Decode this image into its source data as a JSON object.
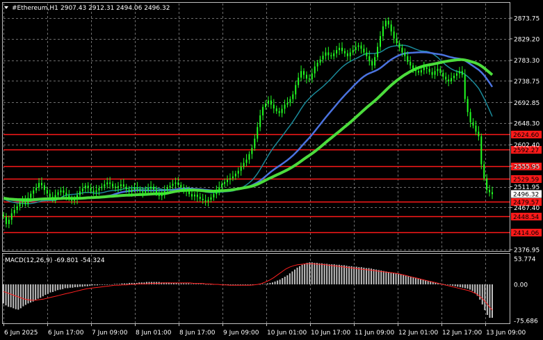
{
  "header": {
    "symbol": "#Ethereum,H1",
    "ohlc": "2907.43 2912.31 2494.06 2496.32"
  },
  "macd": {
    "label": "MACD(12,26,9) -69.801 -54.324",
    "axis_labels": [
      "53.774",
      "0.00",
      "-75.686"
    ],
    "axis_values": [
      53.774,
      0,
      -75.686
    ],
    "histogram": [
      -40,
      -44,
      -47,
      -48,
      -50,
      -52,
      -53,
      -50,
      -46,
      -43,
      -40,
      -38,
      -36,
      -33,
      -30,
      -28,
      -25,
      -22,
      -20,
      -17,
      -16,
      -14,
      -12,
      -11,
      -10,
      -8,
      -8,
      -7,
      -7,
      -6,
      -6,
      -5,
      -5,
      -4,
      -4,
      -3,
      -2,
      -2,
      -2,
      -1,
      -1,
      -1,
      -1,
      0,
      0,
      1,
      1,
      1,
      2,
      2,
      2,
      3,
      3,
      3,
      3,
      4,
      4,
      4,
      5,
      5,
      5,
      5,
      5,
      5,
      4,
      4,
      4,
      4,
      3,
      3,
      3,
      2,
      2,
      2,
      2,
      2,
      1,
      1,
      1,
      1,
      1,
      1,
      0,
      0,
      0,
      0,
      0,
      0,
      -1,
      -1,
      -1,
      -1,
      -1,
      -1,
      -1,
      -1,
      -1,
      -1,
      -1,
      -1,
      -1,
      -1,
      0,
      0,
      0,
      1,
      1,
      2,
      3,
      4,
      6,
      8,
      10,
      13,
      16,
      19,
      23,
      27,
      31,
      35,
      38,
      41,
      43,
      45,
      46,
      46,
      45,
      45,
      44,
      44,
      43,
      43,
      42,
      42,
      42,
      41,
      41,
      40,
      40,
      39,
      38,
      38,
      37,
      37,
      36,
      36,
      35,
      34,
      34,
      33,
      32,
      31,
      30,
      29,
      28,
      27,
      26,
      25,
      24,
      23,
      22,
      21,
      20,
      18,
      17,
      16,
      15,
      13,
      12,
      11,
      10,
      8,
      7,
      6,
      5,
      4,
      3,
      2,
      1,
      0,
      -1,
      -2,
      -3,
      -4,
      -5,
      -6,
      -7,
      -8,
      -9,
      -11,
      -14,
      -18,
      -24,
      -32,
      -42,
      -54,
      -64,
      -70,
      -70
    ],
    "signal": [
      -15,
      -18,
      -21,
      -24,
      -27,
      -30,
      -32,
      -33,
      -33,
      -32,
      -31,
      -29,
      -27,
      -25,
      -23,
      -21,
      -19,
      -17,
      -15,
      -13,
      -11,
      -9,
      -8,
      -7,
      -6,
      -5,
      -4,
      -3,
      -2,
      -2,
      -1,
      -1,
      0,
      0,
      1,
      1,
      1,
      2,
      2,
      2,
      3,
      3,
      3,
      3,
      3,
      3,
      3,
      3,
      2,
      2,
      2,
      1,
      1,
      0,
      0,
      -1,
      -1,
      -2,
      -2,
      -2,
      -2,
      -2,
      -2,
      -1,
      0,
      2,
      5,
      9,
      14,
      20,
      26,
      32,
      36,
      39,
      41,
      42,
      43,
      43,
      43,
      42,
      42,
      41,
      40,
      39,
      38,
      37,
      36,
      35,
      34,
      33,
      32,
      31,
      30,
      29,
      28,
      27,
      26,
      25,
      24,
      23,
      21,
      19,
      17,
      15,
      13,
      11,
      9,
      7,
      5,
      3,
      1,
      -1,
      -3,
      -5,
      -7,
      -9,
      -11,
      -13,
      -16,
      -20,
      -26,
      -34,
      -44,
      -54
    ]
  },
  "price_axis": {
    "labels": [
      "2873.75",
      "2829.20",
      "2783.30",
      "2738.75",
      "2692.85",
      "2648.30",
      "2602.40",
      "2555.95",
      "2511.95",
      "2467.40",
      "2376.95"
    ],
    "values": [
      2873.75,
      2829.2,
      2783.3,
      2738.75,
      2692.85,
      2648.3,
      2602.4,
      2555.95,
      2511.95,
      2467.4,
      2376.95
    ],
    "current_price_label": "2496.32",
    "current_price": 2496.32
  },
  "levels": [
    {
      "label": "2624.60",
      "value": 2624.6
    },
    {
      "label": "2592.27",
      "value": 2592.27
    },
    {
      "label": "2555.95",
      "value": 2555.95
    },
    {
      "label": "2529.59",
      "value": 2529.59
    },
    {
      "label": "2479.57",
      "value": 2479.57
    },
    {
      "label": "2448.54",
      "value": 2448.54
    },
    {
      "label": "2414.06",
      "value": 2414.06
    }
  ],
  "time_axis": [
    "6 Jun 2025",
    "6 Jun 17:00",
    "7 Jun 09:00",
    "8 Jun 01:00",
    "8 Jun 17:00",
    "9 Jun 09:00",
    "10 Jun 01:00",
    "10 Jun 17:00",
    "11 Jun 09:00",
    "12 Jun 01:00",
    "12 Jun 17:00",
    "13 Jun 09:00"
  ],
  "chart_data": {
    "type": "candlestick",
    "title": "#Ethereum,H1",
    "ylim": [
      2365,
      2900
    ],
    "bars_approx": [
      2448,
      2432,
      2441,
      2455,
      2462,
      2470,
      2478,
      2483,
      2475,
      2488,
      2497,
      2504,
      2510,
      2520,
      2515,
      2505,
      2497,
      2490,
      2487,
      2494,
      2500,
      2504,
      2499,
      2493,
      2487,
      2482,
      2485,
      2494,
      2502,
      2508,
      2514,
      2509,
      2503,
      2500,
      2504,
      2509,
      2512,
      2517,
      2521,
      2518,
      2512,
      2509,
      2513,
      2517,
      2512,
      2506,
      2501,
      2506,
      2510,
      2507,
      2502,
      2499,
      2504,
      2508,
      2512,
      2506,
      2498,
      2492,
      2497,
      2503,
      2510,
      2514,
      2518,
      2521,
      2516,
      2510,
      2506,
      2502,
      2496,
      2491,
      2495,
      2490,
      2486,
      2483,
      2480,
      2484,
      2489,
      2496,
      2504,
      2511,
      2518,
      2522,
      2527,
      2530,
      2534,
      2540,
      2546,
      2555,
      2563,
      2570,
      2582,
      2595,
      2615,
      2640,
      2665,
      2683,
      2690,
      2697,
      2688,
      2680,
      2674,
      2670,
      2679,
      2688,
      2692,
      2700,
      2710,
      2730,
      2746,
      2760,
      2752,
      2744,
      2742,
      2755,
      2770,
      2778,
      2785,
      2793,
      2800,
      2794,
      2792,
      2798,
      2805,
      2810,
      2803,
      2798,
      2792,
      2800,
      2805,
      2812,
      2815,
      2808,
      2800,
      2792,
      2781,
      2772,
      2790,
      2812,
      2835,
      2856,
      2868,
      2860,
      2845,
      2830,
      2820,
      2810,
      2800,
      2792,
      2780,
      2772,
      2765,
      2760,
      2757,
      2762,
      2768,
      2765,
      2758,
      2752,
      2760,
      2765,
      2756,
      2748,
      2742,
      2738,
      2745,
      2750,
      2755,
      2760,
      2752,
      2700,
      2672,
      2650,
      2643,
      2630,
      2620,
      2560,
      2530,
      2505,
      2500,
      2496
    ]
  },
  "colors": {
    "background": "#000000",
    "grid": "#c8c8c8",
    "candle": "#22ff22",
    "ma_green": "#4cdc3c",
    "ma_blue": "#4b73e0",
    "ma_teal": "#1a8a9a",
    "level_line": "#ff1a1a",
    "level_label_bg": "#ff1a1a",
    "current_price_bg": "#ffffff",
    "macd_hist": "#c0c0c0",
    "macd_signal": "#ff2020",
    "axis_text": "#ffffff"
  }
}
